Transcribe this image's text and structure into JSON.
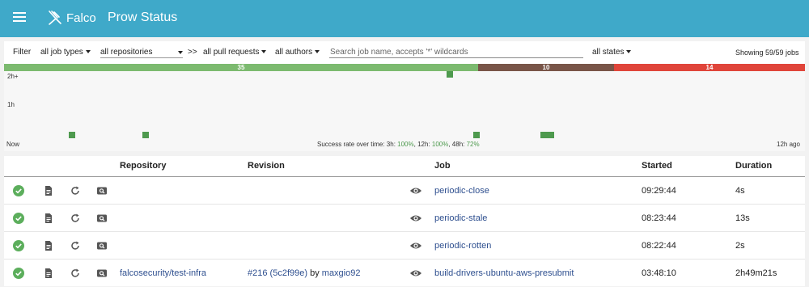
{
  "header": {
    "brand": "Falco",
    "title": "Prow Status",
    "menu_icon": "hamburger-menu-icon",
    "logo_icon": "falco-logo-icon",
    "color": "#3fa9c9"
  },
  "filters": {
    "label": "Filter",
    "job_types": "all job types",
    "repositories": "all repositories",
    "separator": ">>",
    "pull_requests": "all pull requests",
    "authors": "all authors",
    "search_placeholder": "Search job name, accepts '*' wildcards",
    "states": "all states",
    "showing": "Showing 59/59 jobs"
  },
  "summary_bar": {
    "success": "35",
    "pending": "10",
    "failure": "14",
    "colors": {
      "success": "#7cba6f",
      "pending": "#795548",
      "failure": "#e0453a"
    }
  },
  "chart": {
    "y_top": "2h+",
    "y_mid": "1h",
    "x_left": "Now",
    "x_right": "12h ago",
    "success_rate_label": "Success rate over time: 3h: ",
    "rate_3h": "100%",
    "sep_12h": ", 12h: ",
    "rate_12h": "100%",
    "sep_48h": ", 48h: ",
    "rate_48h": "72%"
  },
  "table": {
    "columns": {
      "repository": "Repository",
      "revision": "Revision",
      "job": "Job",
      "started": "Started",
      "duration": "Duration"
    },
    "rows": [
      {
        "status": "success",
        "repository": "",
        "pr": "",
        "sha": "",
        "by": "",
        "author": "",
        "job": "periodic-close",
        "started": "09:29:44",
        "duration": "4s"
      },
      {
        "status": "success",
        "repository": "",
        "pr": "",
        "sha": "",
        "by": "",
        "author": "",
        "job": "periodic-stale",
        "started": "08:23:44",
        "duration": "13s"
      },
      {
        "status": "success",
        "repository": "",
        "pr": "",
        "sha": "",
        "by": "",
        "author": "",
        "job": "periodic-rotten",
        "started": "08:22:44",
        "duration": "2s"
      },
      {
        "status": "success",
        "repository": "falcosecurity/test-infra",
        "pr": "#216",
        "sha": "(5c2f99e)",
        "by": "by",
        "author": "maxgio92",
        "job": "build-drivers-ubuntu-aws-presubmit",
        "started": "03:48:10",
        "duration": "2h49m21s"
      }
    ]
  }
}
